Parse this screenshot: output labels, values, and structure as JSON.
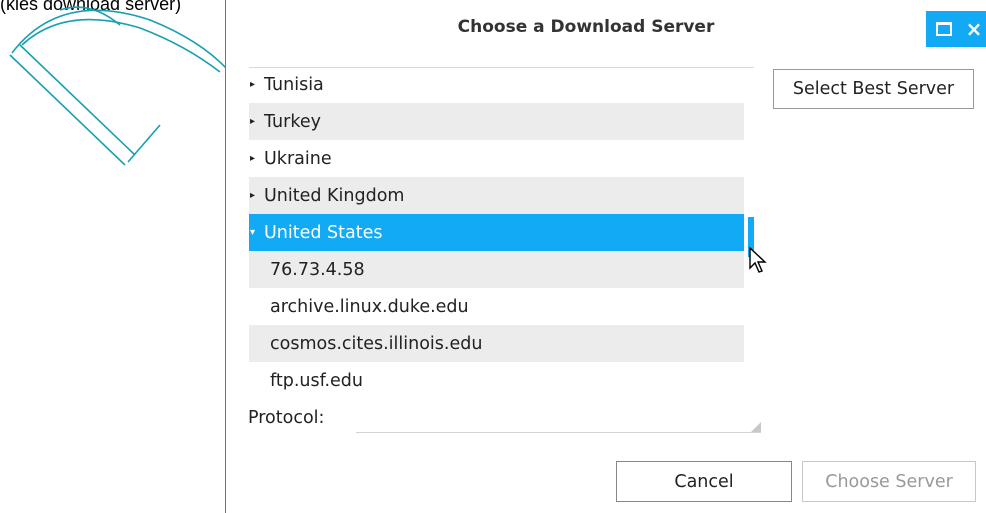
{
  "background": {
    "caption": "(kies download server)"
  },
  "dialog": {
    "title": "Choose a Download Server",
    "maximize_icon": "maximize-icon",
    "close_label": "×",
    "accent_color": "#12aaf5"
  },
  "server_list": {
    "countries": [
      {
        "label": "Tunisia",
        "expanded": false
      },
      {
        "label": "Turkey",
        "expanded": false
      },
      {
        "label": "Ukraine",
        "expanded": false
      },
      {
        "label": "United Kingdom",
        "expanded": false
      },
      {
        "label": "United States",
        "expanded": true,
        "selected": true
      }
    ],
    "servers": [
      "76.73.4.58",
      "archive.linux.duke.edu",
      "cosmos.cites.illinois.edu",
      "ftp.usf.edu"
    ]
  },
  "buttons": {
    "select_best": "Select Best Server",
    "cancel": "Cancel",
    "choose_server": "Choose Server"
  },
  "protocol": {
    "label": "Protocol:",
    "value": ""
  }
}
